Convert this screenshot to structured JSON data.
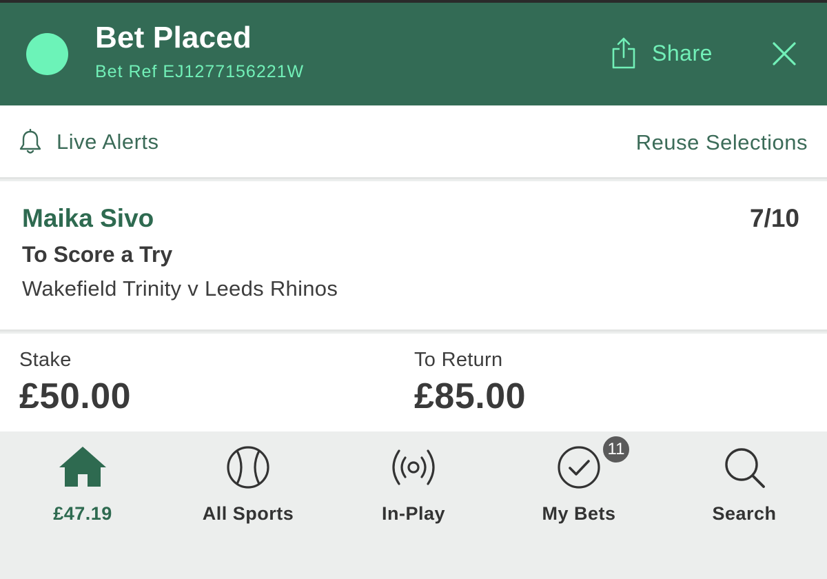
{
  "header": {
    "title": "Bet Placed",
    "bet_ref": "Bet Ref EJ1277156221W",
    "share_label": "Share",
    "status_color": "#6cf3b8",
    "accent_color": "#336b55"
  },
  "alerts_bar": {
    "live_alerts_label": "Live Alerts",
    "reuse_label": "Reuse Selections"
  },
  "selection": {
    "name": "Maika Sivo",
    "odds": "7/10",
    "market": "To Score a Try",
    "event": "Wakefield Trinity v Leeds Rhinos"
  },
  "stake": {
    "stake_label": "Stake",
    "stake_value": "£50.00",
    "return_label": "To Return",
    "return_value": "£85.00"
  },
  "bottom_nav": {
    "items": [
      {
        "label": "£47.19",
        "icon": "home-icon",
        "active": true
      },
      {
        "label": "All Sports",
        "icon": "ball-icon",
        "active": false
      },
      {
        "label": "In-Play",
        "icon": "broadcast-icon",
        "active": false
      },
      {
        "label": "My Bets",
        "icon": "check-circle-icon",
        "active": false,
        "badge": "11"
      },
      {
        "label": "Search",
        "icon": "search-icon",
        "active": false
      }
    ]
  }
}
